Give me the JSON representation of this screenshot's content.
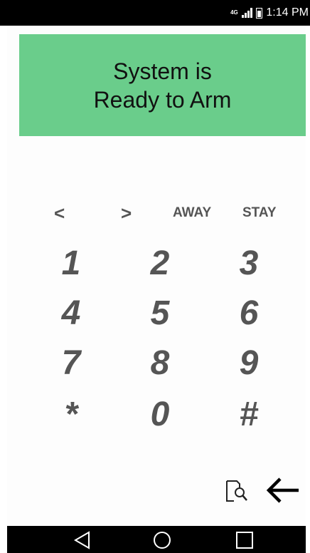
{
  "statusbar": {
    "network": "4G",
    "time": "1:14 PM",
    "icons": [
      "network-4g-icon",
      "signal-icon",
      "battery-icon"
    ]
  },
  "banner": {
    "text": "System is\nReady to Arm",
    "color": "#6acd8b"
  },
  "nav": {
    "prev": "<",
    "next": ">",
    "away": "AWAY",
    "stay": "STAY"
  },
  "keypad": {
    "keys": [
      "1",
      "2",
      "3",
      "4",
      "5",
      "6",
      "7",
      "8",
      "9",
      "*",
      "0",
      "#"
    ]
  },
  "tools": {
    "icons": [
      "lookup-icon",
      "back-arrow-icon"
    ]
  },
  "system_nav": {
    "icons": [
      "back-triangle-icon",
      "home-circle-icon",
      "recents-square-icon"
    ]
  }
}
